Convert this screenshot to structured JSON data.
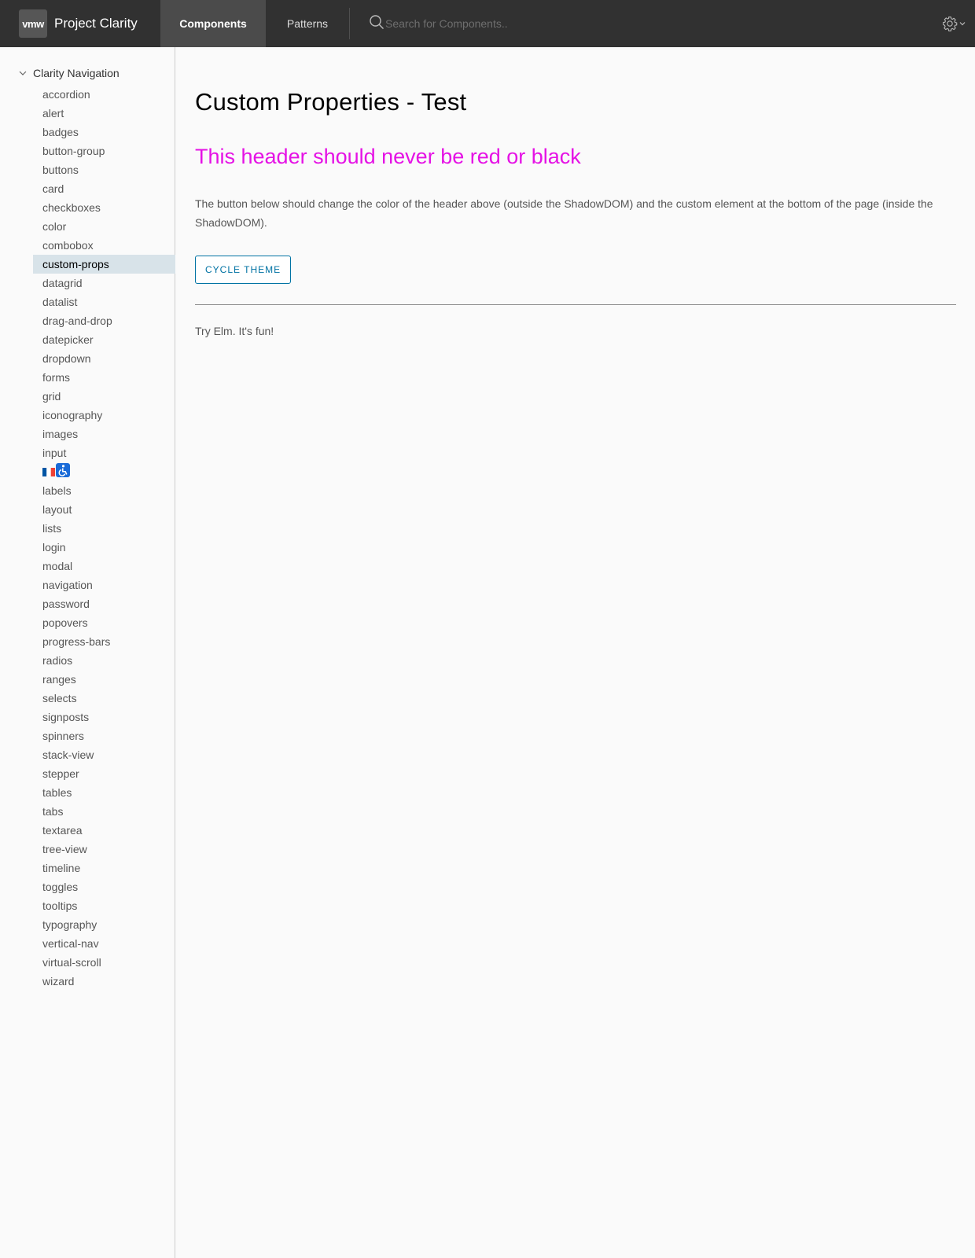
{
  "header": {
    "logo_text": "vmw",
    "brand_title": "Project Clarity",
    "nav": [
      {
        "label": "Components",
        "active": true
      },
      {
        "label": "Patterns",
        "active": false
      }
    ],
    "search_placeholder": "Search for Components..",
    "settings_icon": "gear-icon"
  },
  "sidebar": {
    "root_label": "Clarity Navigation",
    "items": [
      "accordion",
      "alert",
      "badges",
      "button-group",
      "buttons",
      "card",
      "checkboxes",
      "color",
      "combobox",
      "custom-props",
      "datagrid",
      "datalist",
      "drag-and-drop",
      "datepicker",
      "dropdown",
      "forms",
      "grid",
      "iconography",
      "images",
      "input",
      "",
      "labels",
      "layout",
      "lists",
      "login",
      "modal",
      "navigation",
      "password",
      "popovers",
      "progress-bars",
      "radios",
      "ranges",
      "selects",
      "signposts",
      "spinners",
      "stack-view",
      "stepper",
      "tables",
      "tabs",
      "textarea",
      "tree-view",
      "timeline",
      "toggles",
      "tooltips",
      "typography",
      "vertical-nav",
      "virtual-scroll",
      "wizard"
    ],
    "active_item": "custom-props",
    "emoji_item_icons": [
      "french-flag-icon",
      "accessibility-icon"
    ]
  },
  "main": {
    "title": "Custom Properties - Test",
    "subtitle": "This header should never be red or black",
    "description": "The button below should change the color of the header above (outside the ShadowDOM) and the custom element at the bottom of the page (inside the ShadowDOM).",
    "button_label": "CYCLE THEME",
    "footer_text": "Try Elm. It's fun!"
  },
  "colors": {
    "header_bg": "#313131",
    "active_nav_bg": "#4b4b4b",
    "subtitle": "#e512e5",
    "button_accent": "#0072a3",
    "active_item_bg": "#d8e3e9"
  }
}
